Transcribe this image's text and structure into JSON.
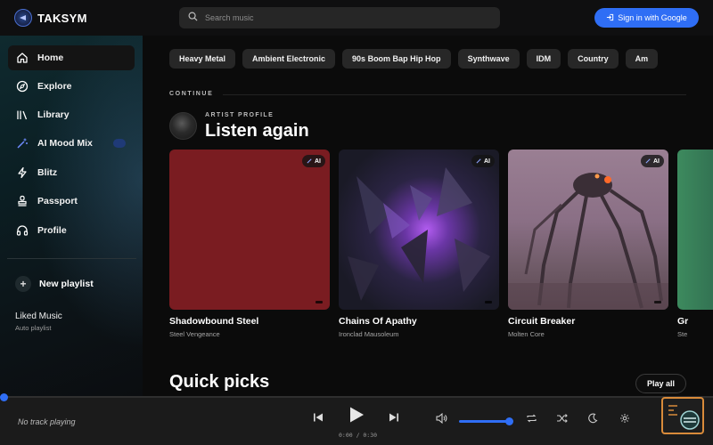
{
  "app": {
    "name": "TAKSYM"
  },
  "search": {
    "placeholder": "Search music"
  },
  "header": {
    "signin_label": "Sign in with Google"
  },
  "sidebar": {
    "items": [
      {
        "label": "Home",
        "icon": "home-icon",
        "active": true
      },
      {
        "label": "Explore",
        "icon": "compass-icon"
      },
      {
        "label": "Library",
        "icon": "library-icon"
      },
      {
        "label": "AI Mood Mix",
        "icon": "magic-wand-icon"
      },
      {
        "label": "Blitz",
        "icon": "lightning-icon"
      },
      {
        "label": "Passport",
        "icon": "stamp-icon"
      },
      {
        "label": "Profile",
        "icon": "headphones-icon"
      }
    ],
    "new_playlist_label": "New playlist",
    "liked": {
      "title": "Liked Music",
      "subtitle": "Auto playlist"
    }
  },
  "main": {
    "chips": [
      "Heavy Metal",
      "Ambient Electronic",
      "90s Boom Bap Hip Hop",
      "Synthwave",
      "IDM",
      "Country",
      "Am"
    ],
    "continue_label": "CONTINUE",
    "artist_profile_label": "ARTIST PROFILE",
    "section_title": "Listen again",
    "ai_badge": "AI",
    "cards": [
      {
        "title": "Shadowbound Steel",
        "artist": "Steel Vengeance",
        "color": "#7a1c21"
      },
      {
        "title": "Chains Of Apathy",
        "artist": "Ironclad Mausoleum",
        "color": "#2a2340"
      },
      {
        "title": "Circuit Breaker",
        "artist": "Molten Core",
        "color": "#8a6f85"
      },
      {
        "title": "Gr",
        "artist": "Ste",
        "color": "#2f6b4f"
      }
    ],
    "quick_picks_title": "Quick picks",
    "play_all_label": "Play all"
  },
  "player": {
    "now_playing": "No track playing",
    "time": "0:00 / 0:30",
    "progress": 0,
    "volume": 1.0,
    "accent": "#2f6ef5"
  }
}
